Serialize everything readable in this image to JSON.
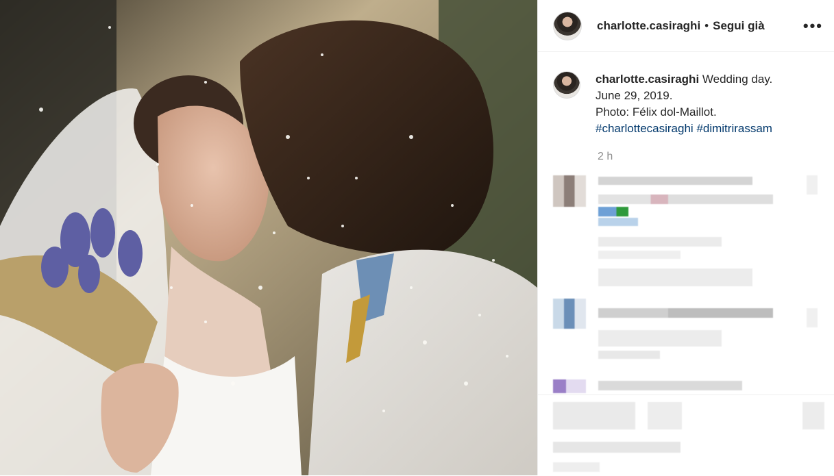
{
  "post": {
    "image_alt": "Wedding kiss photo with lavender bouquet and confetti",
    "username": "charlotte.casiraghi",
    "follow_separator": "•",
    "follow_status": "Segui già",
    "more_label": "•••",
    "caption_username": "charlotte.casiraghi",
    "caption_line1": " Wedding day.",
    "caption_line2": "June 29, 2019.",
    "caption_line3": "Photo: Félix dol-Maillot.",
    "hashtag1": "#charlottecasiraghi",
    "hashtag2": "#dimitrirassam",
    "time_ago": "2 h"
  },
  "colors": {
    "link": "#00376b",
    "muted": "#8e8e8e",
    "border": "#efefef"
  }
}
